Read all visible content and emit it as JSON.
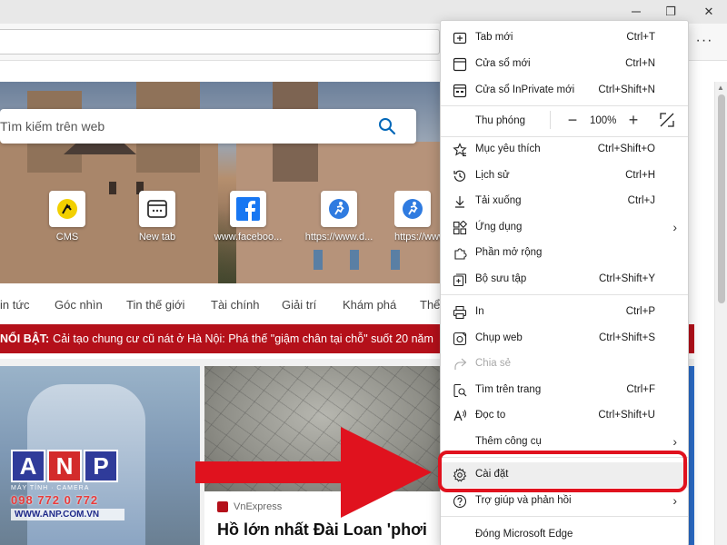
{
  "browser": {
    "window_controls": {
      "restore": "❐",
      "close": "✕"
    },
    "more_button": "···"
  },
  "hero": {
    "search_placeholder": "Tìm kiếm trên web",
    "tiles": [
      {
        "label": "CMS",
        "icon": "cms-icon"
      },
      {
        "label": "New tab",
        "icon": "newtab-icon"
      },
      {
        "label": "www.faceboo...",
        "icon": "facebook-icon"
      },
      {
        "label": "https://www.d...",
        "icon": "runner-icon"
      },
      {
        "label": "https://www.d...",
        "icon": "runner-icon"
      }
    ]
  },
  "news": {
    "nav": [
      "in tức",
      "Góc nhìn",
      "Tin thế giới",
      "Tài chính",
      "Giải trí",
      "Khám phá",
      "Thể"
    ],
    "breaking_label": "NỔI BẬT:",
    "breaking_text": "Cải tạo chung cư cũ nát ở Hà Nội: Phá thế \"giậm chân tại chỗ\" suốt 20 năm",
    "card2_source": "VnExpress",
    "card2_headline": "Hồ lớn nhất Đài Loan 'phơi"
  },
  "watermark": {
    "letters": [
      "A",
      "N",
      "P"
    ],
    "subtitle": "MÁY TÍNH · CAMERA",
    "phone": "098 772 0 772",
    "site": "WWW.ANP.COM.VN"
  },
  "menu": {
    "items": [
      {
        "label": "Tab mới",
        "shortcut": "Ctrl+T",
        "icon": "new-tab-icon"
      },
      {
        "label": "Cửa sổ mới",
        "shortcut": "Ctrl+N",
        "icon": "new-window-icon"
      },
      {
        "label": "Cửa sổ InPrivate mới",
        "shortcut": "Ctrl+Shift+N",
        "icon": "inprivate-icon"
      },
      {
        "label": "Thu phóng",
        "zoom": "100%"
      },
      {
        "label": "Mục yêu thích",
        "shortcut": "Ctrl+Shift+O",
        "icon": "favorites-icon"
      },
      {
        "label": "Lịch sử",
        "shortcut": "Ctrl+H",
        "icon": "history-icon"
      },
      {
        "label": "Tải xuống",
        "shortcut": "Ctrl+J",
        "icon": "download-icon"
      },
      {
        "label": "Ứng dụng",
        "icon": "apps-icon"
      },
      {
        "label": "Phần mở rộng",
        "icon": "extensions-icon"
      },
      {
        "label": "Bộ sưu tập",
        "shortcut": "Ctrl+Shift+Y",
        "icon": "collections-icon"
      },
      {
        "label": "In",
        "shortcut": "Ctrl+P",
        "icon": "print-icon"
      },
      {
        "label": "Chụp web",
        "shortcut": "Ctrl+Shift+S",
        "icon": "web-capture-icon"
      },
      {
        "label": "Chia sẻ",
        "icon": "share-icon"
      },
      {
        "label": "Tìm trên trang",
        "shortcut": "Ctrl+F",
        "icon": "find-icon"
      },
      {
        "label": "Đọc to",
        "shortcut": "Ctrl+Shift+U",
        "icon": "read-aloud-icon"
      },
      {
        "label": "Thêm công cụ"
      },
      {
        "label": "Cài đặt",
        "icon": "settings-icon"
      },
      {
        "label": "Trợ giúp và phản hồi",
        "icon": "help-icon"
      },
      {
        "label": "Đóng Microsoft Edge"
      }
    ]
  },
  "colors": {
    "breaking_bg": "#b4101a",
    "highlight": "#e0121e",
    "arrow": "#e0121e"
  }
}
